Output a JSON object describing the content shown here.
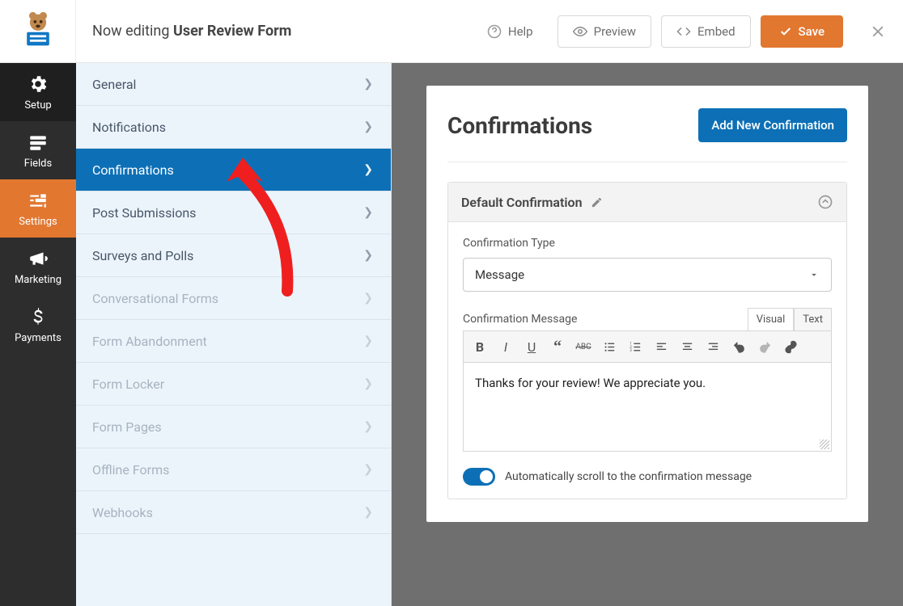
{
  "header": {
    "editing_prefix": "Now editing ",
    "form_name": "User Review Form",
    "help": "Help",
    "preview": "Preview",
    "embed": "Embed",
    "save": "Save"
  },
  "leftnav": {
    "setup": "Setup",
    "fields": "Fields",
    "settings": "Settings",
    "marketing": "Marketing",
    "payments": "Payments"
  },
  "sidepanel": {
    "items": [
      {
        "label": "General",
        "state": "normal"
      },
      {
        "label": "Notifications",
        "state": "normal"
      },
      {
        "label": "Confirmations",
        "state": "active"
      },
      {
        "label": "Post Submissions",
        "state": "normal"
      },
      {
        "label": "Surveys and Polls",
        "state": "normal"
      },
      {
        "label": "Conversational Forms",
        "state": "disabled"
      },
      {
        "label": "Form Abandonment",
        "state": "disabled"
      },
      {
        "label": "Form Locker",
        "state": "disabled"
      },
      {
        "label": "Form Pages",
        "state": "disabled"
      },
      {
        "label": "Offline Forms",
        "state": "disabled"
      },
      {
        "label": "Webhooks",
        "state": "disabled"
      }
    ]
  },
  "main": {
    "title": "Confirmations",
    "add_btn": "Add New Confirmation",
    "panel_title": "Default Confirmation",
    "type_label": "Confirmation Type",
    "type_value": "Message",
    "msg_label": "Confirmation Message",
    "tab_visual": "Visual",
    "tab_text": "Text",
    "msg_content": "Thanks for your review! We appreciate you.",
    "scroll_label": "Automatically scroll to the confirmation message"
  }
}
